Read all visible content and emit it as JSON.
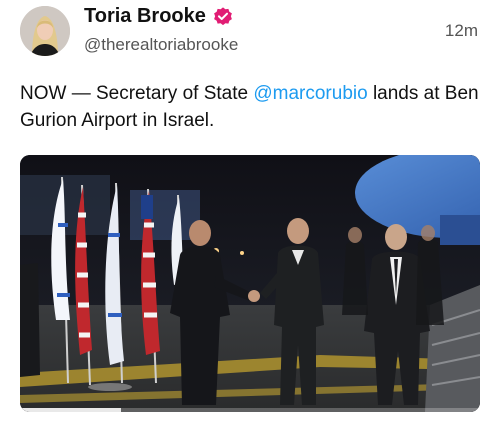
{
  "author": {
    "display_name": "Toria Brooke",
    "handle": "@therealtoriabrooke",
    "verified_icon": "verified-badge-icon"
  },
  "post": {
    "time_ago": "12m",
    "text_before": "NOW — Secretary of State ",
    "mention": "@marcorubio",
    "text_after": " lands at Ben Gurion Airport in Israel."
  },
  "media": {
    "type": "video",
    "progress_fraction": 0.22
  },
  "colors": {
    "mention": "#1d9bf0",
    "verified": "#e11d74"
  }
}
